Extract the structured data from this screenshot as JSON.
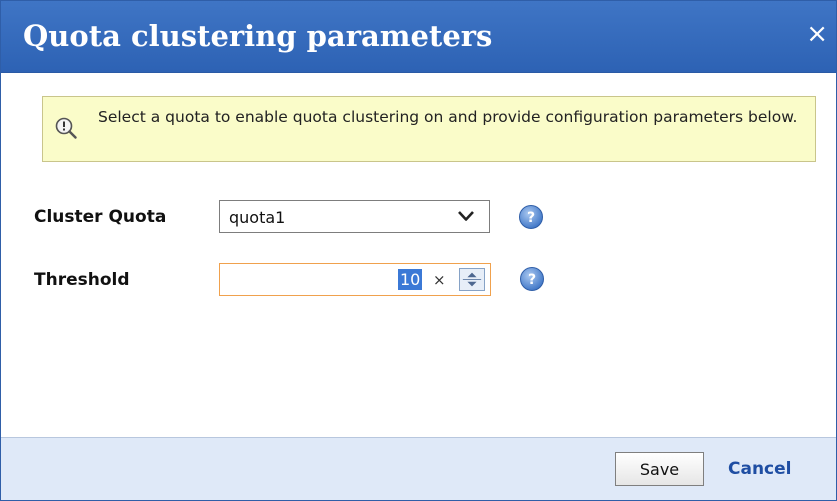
{
  "dialog": {
    "title": "Quota clustering parameters",
    "close_label": "×",
    "info_message": "Select a quota to enable quota clustering on and provide configuration parameters below.",
    "fields": {
      "cluster_quota": {
        "label": "Cluster Quota",
        "value": "quota1"
      },
      "threshold": {
        "label": "Threshold",
        "value": "10",
        "clear_label": "×"
      }
    },
    "buttons": {
      "save": "Save",
      "cancel": "Cancel"
    }
  },
  "colors": {
    "title_bar": "#3a6fc0",
    "info_box": "#fafcc9",
    "footer": "#dfe9f8",
    "focus_border": "#f0a14d",
    "link": "#1f4ea3",
    "selection": "#3b79d6"
  },
  "icons": [
    "close-icon",
    "info-icon",
    "chevron-down-icon",
    "help-icon",
    "stepper-icon"
  ]
}
